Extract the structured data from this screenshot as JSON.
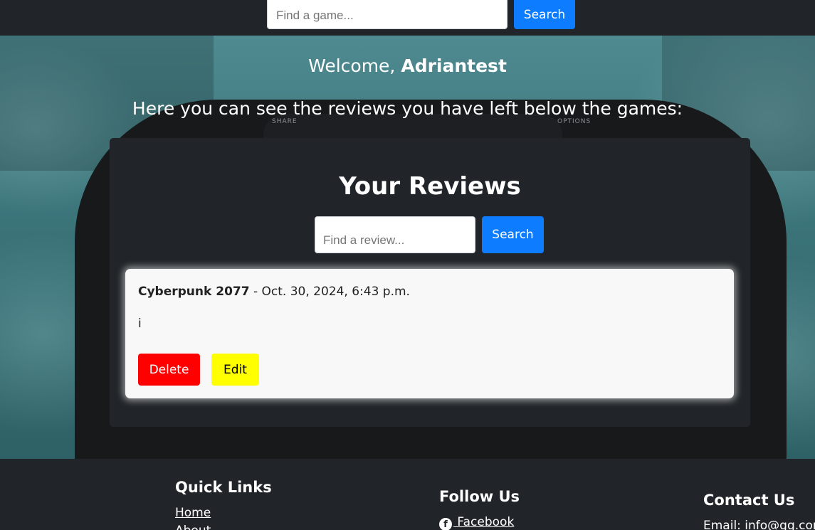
{
  "navbar": {
    "search_placeholder": "Find a game...",
    "search_button": "Search"
  },
  "hero": {
    "welcome_prefix": "Welcome,",
    "username": "Adriantest",
    "subtitle": "Here you can see the reviews you have left below the games:",
    "controller_labels": [
      "SHARE",
      "OPTIONS"
    ]
  },
  "reviews_panel": {
    "title": "Your Reviews",
    "search_placeholder": "Find a review...",
    "search_button": "Search",
    "reviews": [
      {
        "game": "Cyberpunk 2077",
        "separator": " - ",
        "date": "Oct. 30, 2024, 6:43 p.m.",
        "text": "i",
        "delete_label": "Delete",
        "edit_label": "Edit"
      }
    ]
  },
  "footer": {
    "quick_links": {
      "title": "Quick Links",
      "links": [
        "Home",
        "About"
      ]
    },
    "follow_us": {
      "title": "Follow Us",
      "facebook_label": " Facebook"
    },
    "contact_us": {
      "title": "Contact Us",
      "email_prefix": "Email: ",
      "email": "info@gg.com"
    }
  },
  "colors": {
    "dark": "#212529",
    "primary_blue": "#0d7cff",
    "delete_red": "#ff0000",
    "edit_yellow": "#ffff00",
    "card_bg": "#f8f8f8"
  }
}
